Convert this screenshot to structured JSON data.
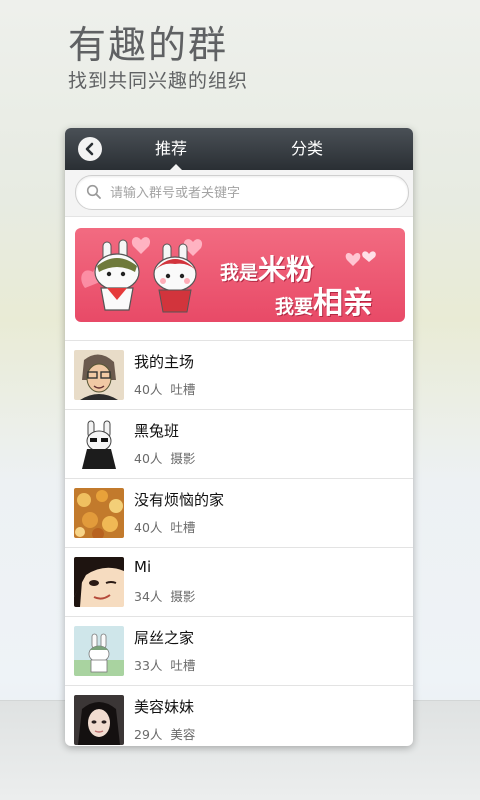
{
  "header": {
    "title": "有趣的群",
    "subtitle": "找到共同兴趣的组织"
  },
  "topbar": {
    "back_icon": "back-arrow-icon",
    "tabs": [
      {
        "label": "推荐",
        "active": true
      },
      {
        "label": "分类",
        "active": false
      }
    ]
  },
  "search": {
    "placeholder": "请输入群号或者关键字",
    "icon": "search-icon"
  },
  "banner": {
    "line1_prefix": "我是",
    "line1_big": "米粉",
    "line2_prefix": "我要",
    "line2_big": "相亲"
  },
  "groups": [
    {
      "name": "我的主场",
      "members": "40人",
      "tag": "吐槽"
    },
    {
      "name": "黑兔班",
      "members": "40人",
      "tag": "摄影"
    },
    {
      "name": "没有烦恼的家",
      "members": "40人",
      "tag": "吐槽"
    },
    {
      "name": "Mi",
      "members": "34人",
      "tag": "摄影"
    },
    {
      "name": "屌丝之家",
      "members": "33人",
      "tag": "吐槽"
    },
    {
      "name": "美容妹妹",
      "members": "29人",
      "tag": "美容"
    }
  ],
  "colors": {
    "topbar": "#2f3439",
    "banner": "#ec5570",
    "divider": "#e3e3e3"
  }
}
